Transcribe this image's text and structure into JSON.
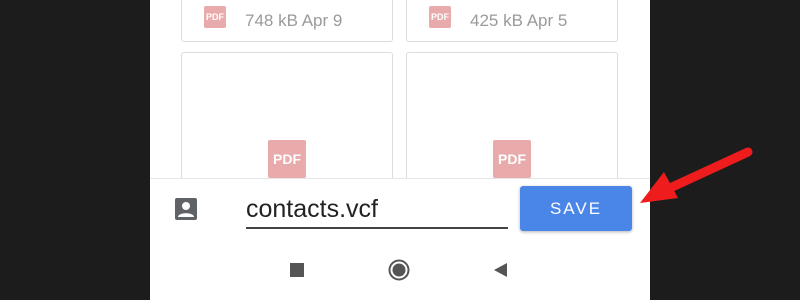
{
  "files": [
    {
      "meta": "748 kB Apr 9",
      "type_label": "PDF"
    },
    {
      "meta": "425 kB Apr 5",
      "type_label": "PDF"
    },
    {
      "meta": "",
      "type_label": "PDF"
    },
    {
      "meta": "",
      "type_label": "PDF"
    }
  ],
  "save_bar": {
    "filename": "contacts.vcf",
    "save_label": "SAVE",
    "account_icon": "account-box-icon"
  },
  "navbar": {
    "recents_icon": "square-icon",
    "home_icon": "circle-icon",
    "back_icon": "triangle-back-icon"
  },
  "colors": {
    "accent": "#4a86e8",
    "pdf_badge": "#e8aaaa",
    "annotation_arrow": "#ee1c1c",
    "background": "#1c1c1c"
  }
}
